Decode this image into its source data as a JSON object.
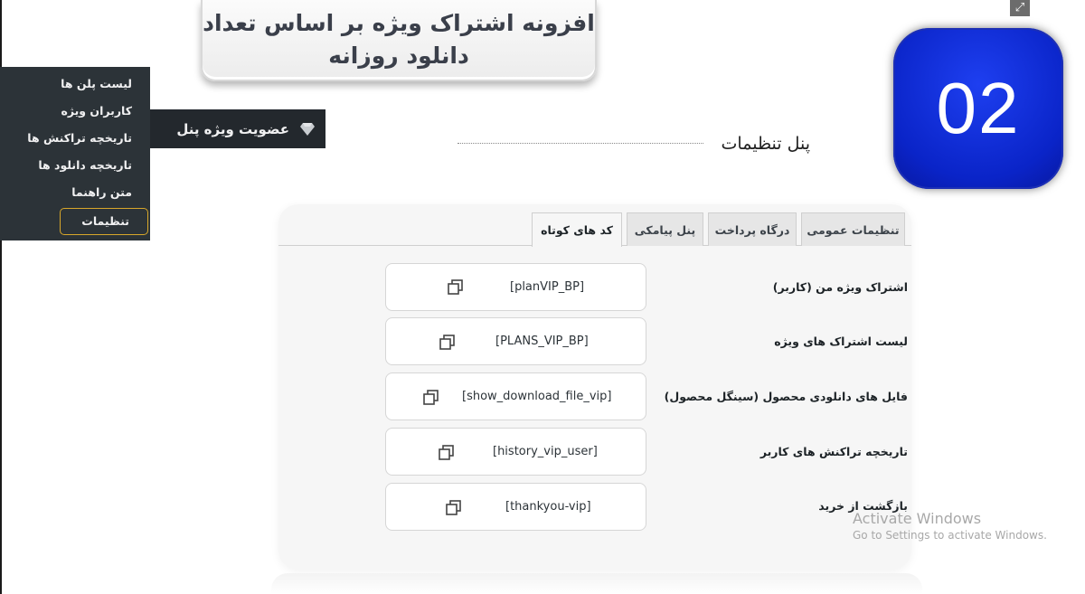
{
  "title": {
    "line1": "افزونه اشتراک ویژه بر اساس تعداد",
    "line2": "دانلود روزانه"
  },
  "step_badge": "02",
  "icons": {
    "expand": "expand-icon",
    "diamond": "diamond-icon",
    "copy": "copy-icon"
  },
  "wp_menu": {
    "head_label": "عضویت ویژه پنل",
    "items": [
      {
        "label": "لیست پلن ها"
      },
      {
        "label": "کاربران ویژه"
      },
      {
        "label": "تاریخچه تراکنش ها"
      },
      {
        "label": "تاریخچه دانلود ها"
      },
      {
        "label": "متن راهنما"
      },
      {
        "label": "تنظیمات",
        "active": true
      }
    ]
  },
  "caption": "پنل تنظیمات",
  "tabs": [
    {
      "label": "تنظیمات عمومی"
    },
    {
      "label": "درگاه پرداخت"
    },
    {
      "label": "پنل پیامکی"
    },
    {
      "label": "کد های کوتاه",
      "active": true
    }
  ],
  "shortcodes": [
    {
      "label": "اشتراک ویژه من (کاربر)",
      "code": "[planVIP_BP]"
    },
    {
      "label": "لیست اشتراک های ویژه",
      "code": "[PLANS_VIP_BP]"
    },
    {
      "label": "فایل های دانلودی محصول (سینگل محصول)",
      "code": "[show_download_file_vip]"
    },
    {
      "label": "تاریخچه تراکنش های کاربر",
      "code": "[history_vip_user]"
    },
    {
      "label": "بازگشت از خرید",
      "code": "[thankyou-vip]"
    }
  ],
  "watermark": {
    "title": "Activate Windows",
    "subtitle": "Go to Settings to activate Windows."
  },
  "colors": {
    "badge_blue": "#0a24c8",
    "wp_dark": "#2c3338",
    "active_outline": "#d8a72a"
  }
}
